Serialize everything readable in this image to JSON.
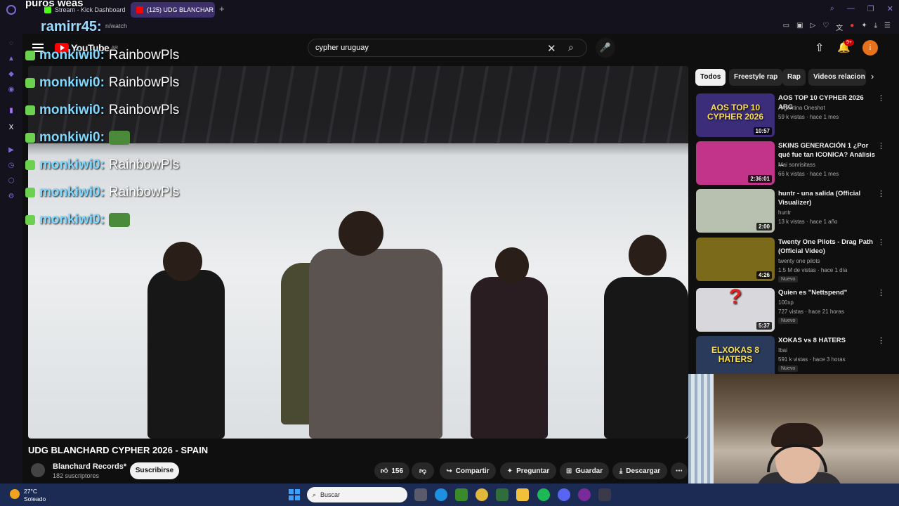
{
  "browser": {
    "tabs": [
      {
        "label": "Stream - Kick Dashboard"
      },
      {
        "label": "(125) UDG BLANCHAR"
      }
    ],
    "url": "n/watch"
  },
  "youtube": {
    "logo": "YouTube",
    "logo_region": "AR",
    "search_value": "cypher uruguay",
    "notification_count": "9+",
    "avatar_initial": "i"
  },
  "chat_overlay": {
    "top_text": "puros weas",
    "top_user": "ramirr45:",
    "lines": [
      {
        "user": "monkiwi0:",
        "msg": "RainbowPls"
      },
      {
        "user": "monkiwi0:",
        "msg": "RainbowPls"
      },
      {
        "user": "monkiwi0:",
        "msg": "RainbowPls"
      },
      {
        "user": "monkiwi0:",
        "msg": ""
      },
      {
        "user": "monkiwi0:",
        "msg": "RainbowPls"
      },
      {
        "user": "monkiwi0:",
        "msg": "RainbowPls"
      },
      {
        "user": "monkiwi0:",
        "msg": ""
      }
    ]
  },
  "video": {
    "title": "UDG BLANCHARD CYPHER 2026 - SPAIN",
    "channel": "Blanchard Records*",
    "subscribers": "182 suscriptores",
    "subscribe_label": "Suscribirse",
    "likes": "156",
    "share_label": "Compartir",
    "ask_label": "Preguntar",
    "save_label": "Guardar",
    "download_label": "Descargar"
  },
  "chips": [
    "Todos",
    "Freestyle rap",
    "Rap",
    "Videos relacion"
  ],
  "recommendations": [
    {
      "title": "AOS TOP 10 CYPHER 2026 ARG",
      "channel": "Argentina Oneshot",
      "meta": "59 k vistas · hace 1 mes",
      "duration": "10:57",
      "badge": "",
      "color": "#3b2d7a"
    },
    {
      "title": "SKINS GENERACIÓN 1 ¿Por qué fue tan ICONICA? Análisis ...",
      "channel": "Mai sonrisitass",
      "meta": "66 k vistas · hace 1 mes",
      "duration": "2:36:01",
      "badge": "",
      "color": "#c2338a"
    },
    {
      "title": "huntr - una salida (Official Visualizer)",
      "channel": "huntr",
      "meta": "13 k vistas · hace 1 año",
      "duration": "2:00",
      "badge": "",
      "color": "#b8c0b0"
    },
    {
      "title": "Twenty One Pilots - Drag Path (Official Video)",
      "channel": "twenty one pilots",
      "meta": "1.5 M de vistas · hace 1 día",
      "duration": "4:26",
      "badge": "Nuevo",
      "color": "#7a6a1a"
    },
    {
      "title": "Quien es \"Nettspend\"",
      "channel": "100xp",
      "meta": "727 vistas · hace 21 horas",
      "duration": "5:37",
      "badge": "Nuevo",
      "color": "#d8d8dc"
    },
    {
      "title": "XOKAS vs 8 HATERS",
      "channel": "Ibai",
      "meta": "591 k vistas · hace 3 horas",
      "duration": "",
      "badge": "Nuevo",
      "color": "#2a3a5a"
    }
  ],
  "rec_thumb_texts": [
    "AOS TOP 10 CYPHER 2026",
    "",
    "",
    "",
    "?",
    "ELXOKAS 8 HATERS"
  ],
  "taskbar": {
    "temp": "27°C",
    "weather": "Soleado",
    "search_placeholder": "Buscar"
  }
}
